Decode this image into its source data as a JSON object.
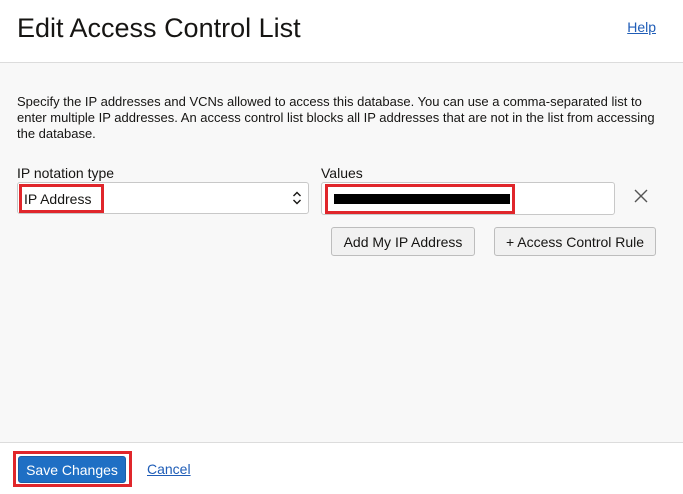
{
  "dialog": {
    "title": "Edit Access Control List",
    "help_label": "Help",
    "description": "Specify the IP addresses and VCNs allowed to access this database. You can use a comma-separated list to enter multiple IP addresses. An access control list blocks all IP addresses that are not in the list from accessing the database."
  },
  "form": {
    "ip_notation_label": "IP notation type",
    "ip_notation_value": "IP Address",
    "values_label": "Values",
    "values_input": "[redacted]",
    "add_my_ip_label": "Add My IP Address",
    "add_rule_label": "+ Access Control Rule"
  },
  "footer": {
    "save_label": "Save Changes",
    "cancel_label": "Cancel"
  },
  "colors": {
    "primary_button": "#1f6fc4",
    "link": "#1f5db7",
    "highlight": "#e0262b"
  },
  "icons": {
    "select_arrows": "chevron-up-down-icon",
    "remove": "close-icon"
  }
}
